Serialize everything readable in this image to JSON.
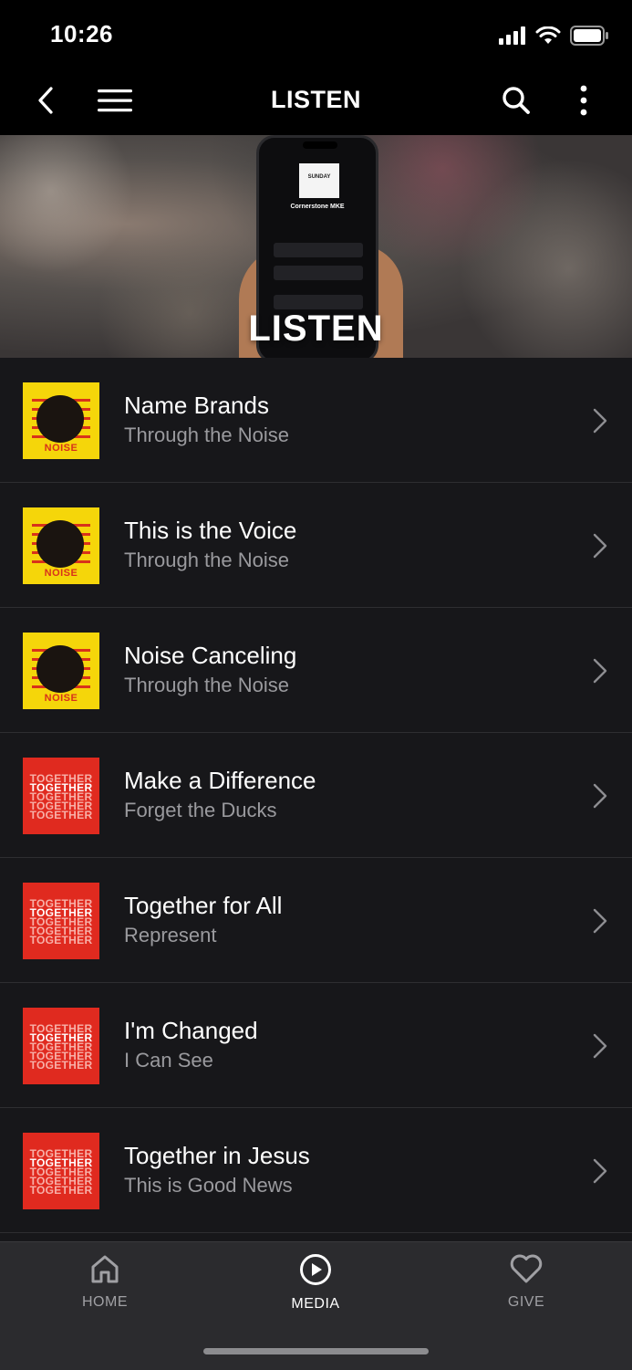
{
  "status_bar": {
    "time": "10:26"
  },
  "nav": {
    "title": "LISTEN"
  },
  "hero": {
    "title": "LISTEN",
    "phone_screen_title": "Cornerstone MKE",
    "phone_art_label": "SUNDAY"
  },
  "items": [
    {
      "title": "Name Brands",
      "subtitle": "Through the Noise",
      "art": "noise"
    },
    {
      "title": "This is the Voice",
      "subtitle": "Through the Noise",
      "art": "noise"
    },
    {
      "title": "Noise Canceling",
      "subtitle": "Through the Noise",
      "art": "noise"
    },
    {
      "title": "Make a Difference",
      "subtitle": "Forget the Ducks",
      "art": "together"
    },
    {
      "title": "Together for All",
      "subtitle": "Represent",
      "art": "together"
    },
    {
      "title": "I'm Changed",
      "subtitle": "I Can See",
      "art": "together"
    },
    {
      "title": "Together in Jesus",
      "subtitle": "This is Good News",
      "art": "together"
    }
  ],
  "art_text": {
    "noise": "NOISE",
    "together": "TOGETHER"
  },
  "tabs": [
    {
      "label": "HOME",
      "icon": "home-icon",
      "active": false
    },
    {
      "label": "MEDIA",
      "icon": "play-circle-icon",
      "active": true
    },
    {
      "label": "GIVE",
      "icon": "heart-icon",
      "active": false
    }
  ],
  "colors": {
    "background": "#17171a",
    "noise_art": "#f5d60a",
    "together_art": "#e02a1f",
    "subtitle": "#9a9a9e"
  }
}
